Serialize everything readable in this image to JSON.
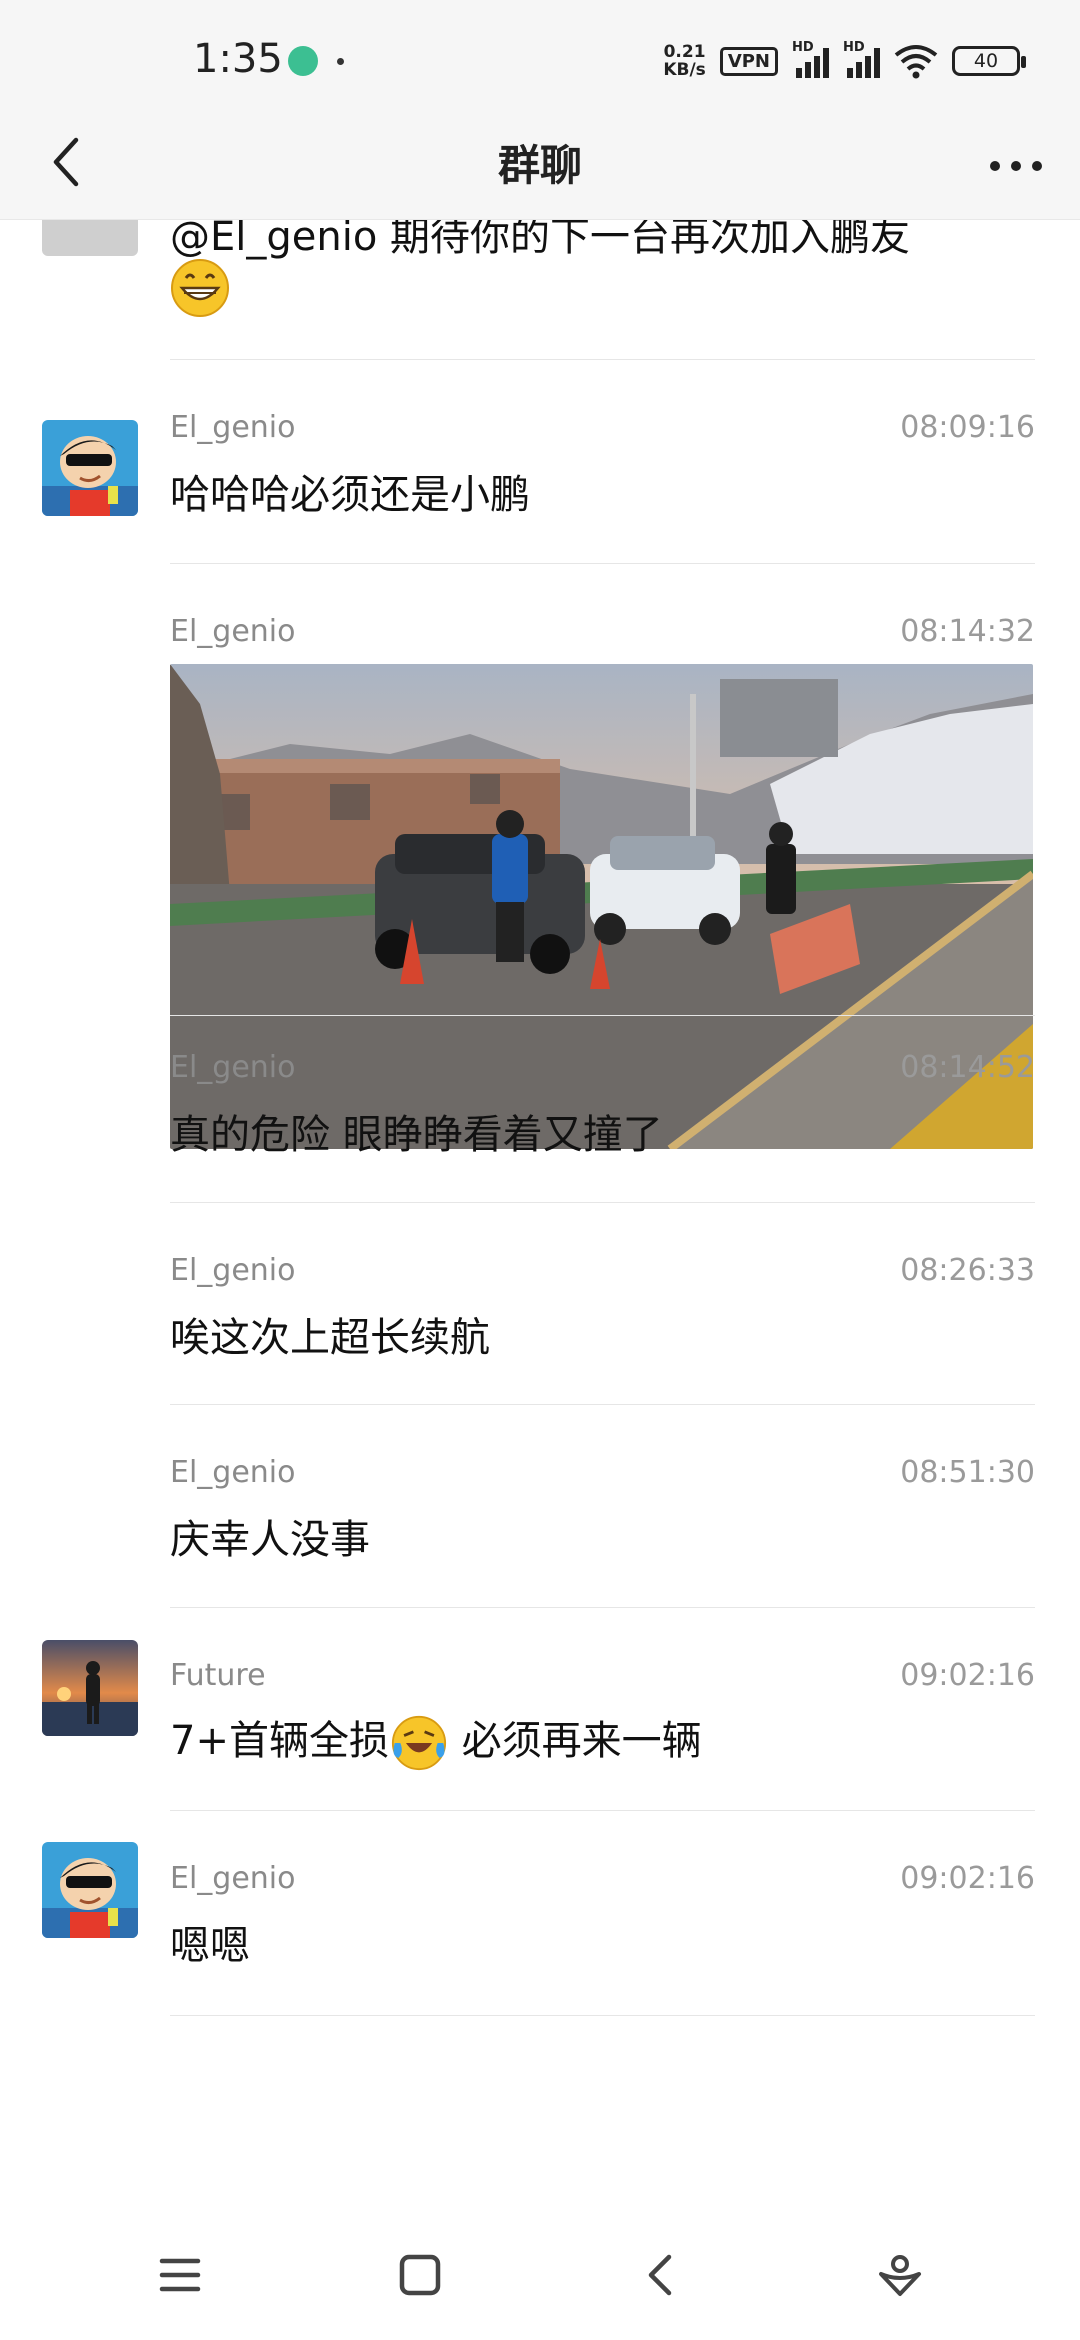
{
  "status": {
    "time": "1:35",
    "net_speed_value": "0.21",
    "net_speed_unit": "KB/s",
    "vpn": "VPN",
    "hd1": "HD",
    "hd2": "HD",
    "battery": "40"
  },
  "header": {
    "title": "群聊"
  },
  "messages": [
    {
      "id": "m0",
      "text": "@El_genio 期待你的下一台再次加入鹏友"
    },
    {
      "id": "m1",
      "sender": "El_genio",
      "time": "08:09:16",
      "text": "哈哈哈必须还是小鹏"
    },
    {
      "id": "m2",
      "sender": "El_genio",
      "time": "08:14:32",
      "type": "image"
    },
    {
      "id": "m3",
      "sender": "El_genio",
      "time": "08:14:52",
      "text": "真的危险 眼睁睁看着又撞了"
    },
    {
      "id": "m4",
      "sender": "El_genio",
      "time": "08:26:33",
      "text": "唉这次上超长续航"
    },
    {
      "id": "m5",
      "sender": "El_genio",
      "time": "08:51:30",
      "text": "庆幸人没事"
    },
    {
      "id": "m6",
      "sender": "Future",
      "time": "09:02:16",
      "text_before": "7+首辆全损",
      "text_after": " 必须再来一辆"
    },
    {
      "id": "m7",
      "sender": "El_genio",
      "time": "09:02:16",
      "text": "嗯嗯"
    }
  ],
  "icons": {
    "back": "chevron-left-icon",
    "more": "more-dots-icon",
    "grin": "grinning-emoji-icon",
    "cry": "crying-laughing-emoji-icon",
    "nav_menu": "menu-icon",
    "nav_home": "home-square-icon",
    "nav_back": "back-triangle-icon",
    "nav_assist": "assistant-icon"
  },
  "colors": {
    "background": "#ffffff",
    "header_bg": "#f6f6f6",
    "meta_text": "#8a8a8a",
    "divider": "#e6e6e6",
    "emoji_yellow": "#f7c529"
  }
}
